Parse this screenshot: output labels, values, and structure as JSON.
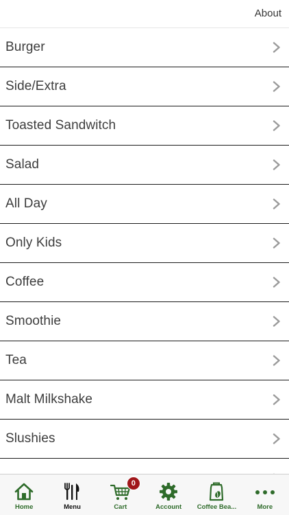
{
  "header": {
    "about_label": "About"
  },
  "menu": {
    "items": [
      {
        "label": "Burger"
      },
      {
        "label": "Side/Extra"
      },
      {
        "label": "Toasted Sandwitch"
      },
      {
        "label": "Salad"
      },
      {
        "label": "All Day"
      },
      {
        "label": "Only Kids"
      },
      {
        "label": "Coffee"
      },
      {
        "label": "Smoothie"
      },
      {
        "label": "Tea"
      },
      {
        "label": "Malt Milkshake"
      },
      {
        "label": "Slushies"
      }
    ]
  },
  "tabs": {
    "home": "Home",
    "menu": "Menu",
    "cart": "Cart",
    "cart_count": "0",
    "account": "Account",
    "coffee": "Coffee Bea...",
    "more": "More"
  },
  "colors": {
    "brand_green": "#2e6b2a",
    "badge_red": "#a0161a",
    "chevron": "#9a9a9a"
  },
  "icons": {
    "home": "home-icon",
    "menu": "fork-knife-icon",
    "cart": "cart-icon",
    "account": "gear-icon",
    "coffee": "coffee-bag-icon",
    "more": "more-dots-icon",
    "chevron": "chevron-right-icon"
  }
}
